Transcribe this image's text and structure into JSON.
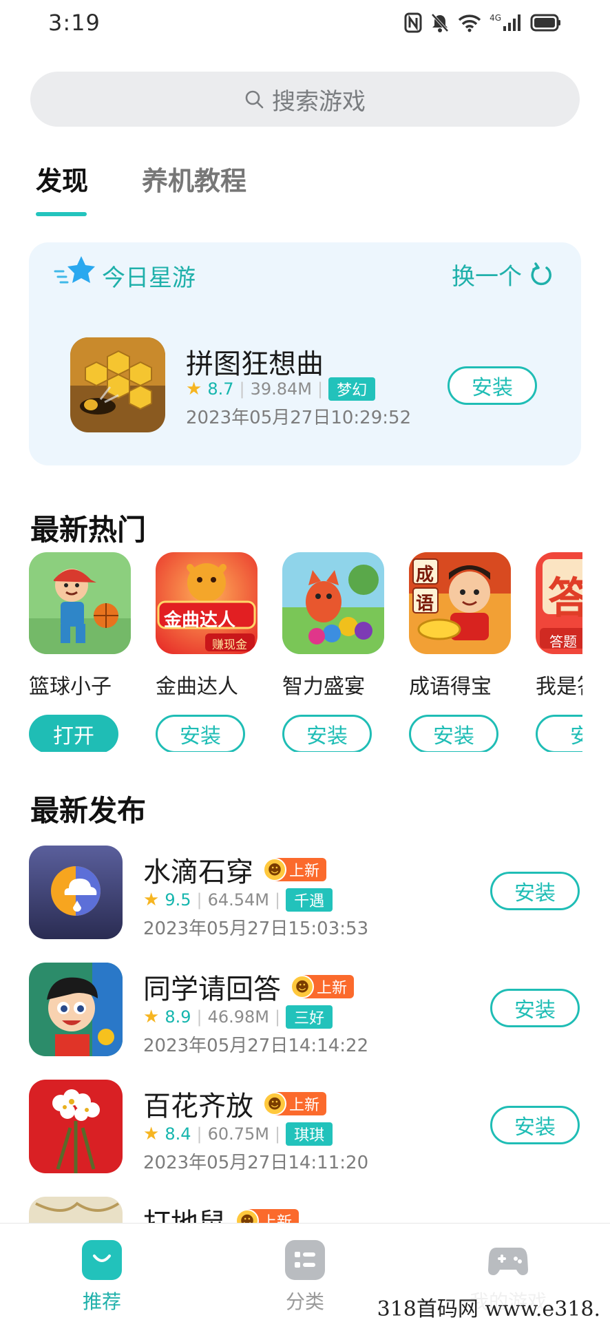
{
  "status_bar": {
    "time": "3:19",
    "network": "4G"
  },
  "search": {
    "placeholder": "搜索游戏"
  },
  "tabs": [
    {
      "label": "发现",
      "active": true
    },
    {
      "label": "养机教程",
      "active": false
    }
  ],
  "featured": {
    "title": "今日星游",
    "refresh_label": "换一个",
    "app": {
      "name": "拼图狂想曲",
      "rating": "8.7",
      "size": "39.84M",
      "tag": "梦幻",
      "date": "2023年05月27日10:29:52",
      "button": "安装"
    }
  },
  "hot": {
    "title": "最新热门",
    "items": [
      {
        "name": "篮球小子",
        "button": "打开",
        "installed": true
      },
      {
        "name": "金曲达人",
        "button": "安装",
        "installed": false,
        "icon_text": "金曲达人",
        "icon_subtext": "赚现金"
      },
      {
        "name": "智力盛宴",
        "button": "安装",
        "installed": false
      },
      {
        "name": "成语得宝",
        "button": "安装",
        "installed": false,
        "icon_text_1": "成",
        "icon_text_2": "语"
      },
      {
        "name": "我是答",
        "button": "安",
        "installed": false,
        "icon_text": "答",
        "icon_subtext": "答题"
      }
    ]
  },
  "latest": {
    "title": "最新发布",
    "badge_label": "上新",
    "items": [
      {
        "name": "水滴石穿",
        "rating": "9.5",
        "size": "64.54M",
        "tag": "千遇",
        "date": "2023年05月27日15:03:53",
        "button": "安装"
      },
      {
        "name": "同学请回答",
        "rating": "8.9",
        "size": "46.98M",
        "tag": "三好",
        "date": "2023年05月27日14:14:22",
        "button": "安装"
      },
      {
        "name": "百花齐放",
        "rating": "8.4",
        "size": "60.75M",
        "tag": "琪琪",
        "date": "2023年05月27日14:11:20",
        "button": "安装"
      },
      {
        "name": "打地鼠"
      }
    ]
  },
  "bottom_nav": [
    {
      "label": "推荐",
      "active": true
    },
    {
      "label": "分类",
      "active": false
    },
    {
      "label": "我的游戏",
      "active": false
    }
  ],
  "watermark": "318首码网 www.e318.",
  "colors": {
    "accent": "#1fbdb5",
    "badge_orange": "#fb6a2c",
    "star": "#f6b521"
  }
}
